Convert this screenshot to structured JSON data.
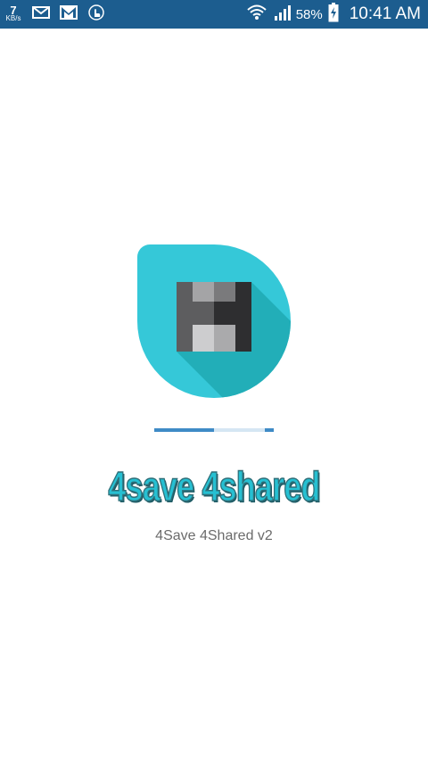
{
  "status_bar": {
    "speed_value": "7",
    "speed_unit": "KB/s",
    "battery_percent": "58%",
    "time": "10:41 AM",
    "left_icons": [
      "email-icon",
      "gmail-icon",
      "touch-app-icon"
    ],
    "right_icons": [
      "wifi-icon",
      "signal-icon",
      "battery-charging-icon"
    ]
  },
  "splash": {
    "progress": 0.5,
    "app_name": "4save 4shared",
    "version_text": "4Save 4Shared v2"
  },
  "colors": {
    "status_bar_bg": "#1c5d8f",
    "logo_bg": "#35c8d8",
    "accent": "#26c0d2",
    "progress": "#3f8bc6"
  }
}
